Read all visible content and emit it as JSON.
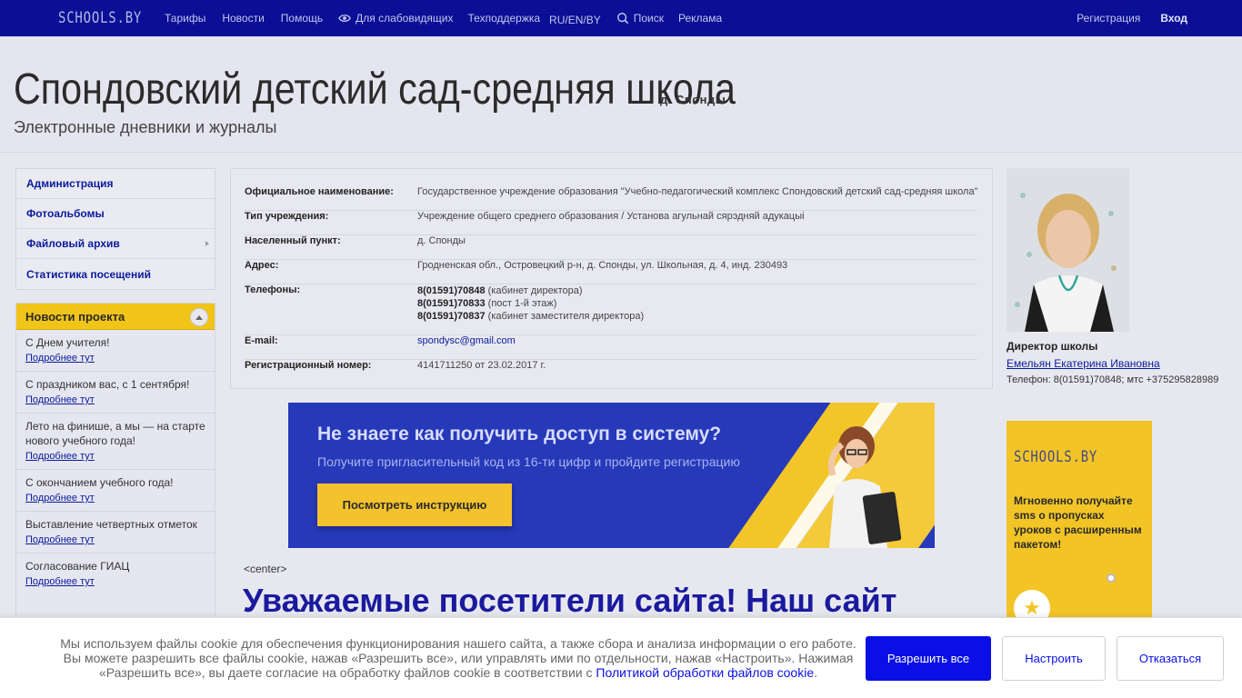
{
  "topnav": {
    "logo": "SCHOOLS.BY",
    "items": [
      "Тарифы",
      "Новости",
      "Помощь",
      "Для слабовидящих",
      "Техподдержка",
      "RU/EN/BY",
      "Поиск",
      "Реклама"
    ],
    "register": "Регистрация",
    "login": "Вход"
  },
  "header": {
    "title": "Спондовский детский сад-средняя школа",
    "locality": "д. Спонды",
    "subtitle": "Электронные дневники и журналы"
  },
  "sidebar": {
    "items": [
      "Администрация",
      "Фотоальбомы",
      "Файловый архив",
      "Статистика посещений"
    ]
  },
  "news": {
    "title": "Новости проекта",
    "more_label": "Подробнее тут",
    "items": [
      "С Днем учителя!",
      "С праздником вас, с 1 сентября!",
      "Лето на финише, а мы — на старте нового учебного года!",
      "С окончанием учебного года!",
      "Выставление четвертных отметок",
      "Согласование ГИАЦ"
    ]
  },
  "info": {
    "official_name_label": "Официальное наименование:",
    "official_name": "Государственное учреждение образования \"Учебно-педагогический комплекс Спондовский детский сад-средняя школа\"",
    "type_label": "Тип учреждения:",
    "type": "Учреждение общего среднего образования / Установа агульнай сярэдняй адукацыі",
    "locality_label": "Населенный пункт:",
    "locality": "д. Спонды",
    "address_label": "Адрес:",
    "address": "Гродненская обл., Островецкий р-н, д. Спонды, ул. Школьная, д. 4, инд. 230493",
    "phones_label": "Телефоны:",
    "phones": [
      {
        "number": "8(01591)70848",
        "note": " (кабинет директора)"
      },
      {
        "number": "8(01591)70833",
        "note": " (пост 1-й этаж)"
      },
      {
        "number": "8(01591)70837",
        "note": " (кабинет заместителя директора)"
      }
    ],
    "email_label": "E-mail:",
    "email": "spondysc@gmail.com",
    "reg_label": "Регистрационный номер:",
    "reg": "4141711250 от 23.02.2017 г."
  },
  "banner": {
    "heading": "Не знаете как получить доступ в систему?",
    "sub": "Получите пригласительный код из 16-ти цифр и пройдите регистрацию",
    "button": "Посмотреть инструкцию"
  },
  "content": {
    "center_tag": "<center>",
    "heading": "Уважаемые посетители сайта! Наш сайт"
  },
  "director": {
    "role": "Директор школы",
    "name": "Емельян Екатерина Ивановна",
    "phone": "Телефон: 8(01591)70848; мтс +375295828989"
  },
  "ad": {
    "logo": "SCHOOLS.BY",
    "text": "Мгновенно получайте sms о пропусках уроков с расширенным пакетом!"
  },
  "cookie": {
    "text": "Мы используем файлы cookie для обеспечения функционирования нашего сайта, а также сбора и анализа информации о его работе. Вы можете разрешить все файлы cookie, нажав «Разрешить все», или управлять ими по отдельности, нажав «Настроить». Нажимая «Разрешить все», вы даете согласие на обработку файлов cookie в соответствии с ",
    "link": "Политикой обработки файлов cookie",
    "dot": ".",
    "allow": "Разрешить все",
    "configure": "Настроить",
    "deny": "Отказаться"
  }
}
